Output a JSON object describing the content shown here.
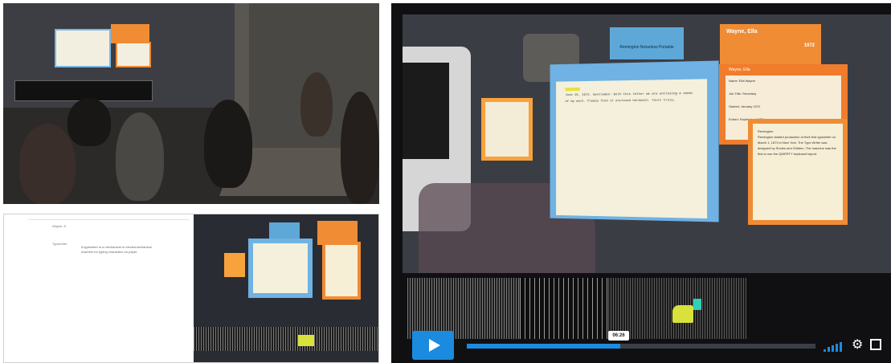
{
  "video": {
    "tag_blue_text": "Remington Noiseless Portable",
    "tag_orange_name": "Wayne, Ella",
    "tag_orange_date": "1972",
    "info_card_header": "Wayne, Ella",
    "info_lines": [
      "Name: Ella Wayne",
      "Job Title: Secretary",
      "Started: January 1972",
      "Ended: September 1972"
    ],
    "bio_title": "Remington",
    "bio_text": "Remington started production of their first typewriter on March 1, 1873 in New York. The Type Writer was designed by Sholes and Glidden. The machine was the first to use the QWERTY keyboard layout.",
    "letter_text": "June 15, 1972. Gentlemen: With this letter we are enclosing a sheet of my work. Please find it enclosed herewith. Yours truly,",
    "time_badge": "06:26",
    "progress": 0.44,
    "accent_color": "#1b8be0"
  },
  "webpage": {
    "title_label": "Wayne, E.",
    "side_label": "Typewriter",
    "caption": "A typewriter is a mechanical or electromechanical machine for typing characters on paper."
  }
}
